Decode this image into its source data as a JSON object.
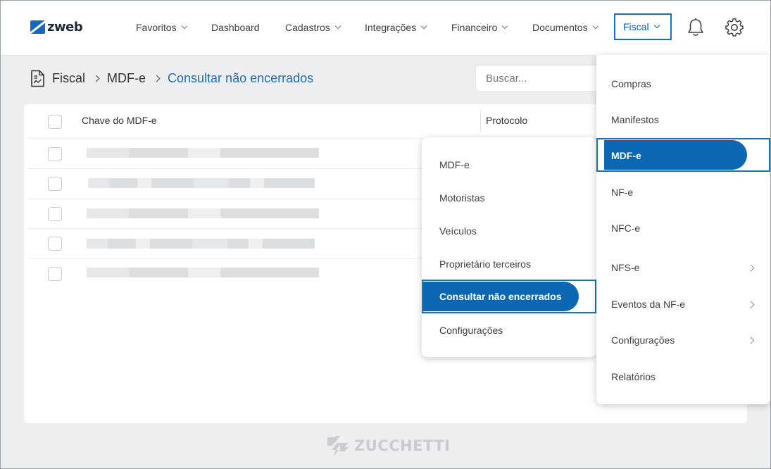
{
  "app": {
    "logo_text": "zweb"
  },
  "nav": {
    "items": [
      {
        "label": "Favoritos",
        "has_chevron": true
      },
      {
        "label": "Dashboard",
        "has_chevron": false
      },
      {
        "label": "Cadastros",
        "has_chevron": true
      },
      {
        "label": "Integrações",
        "has_chevron": true
      },
      {
        "label": "Financeiro",
        "has_chevron": true
      },
      {
        "label": "Documentos",
        "has_chevron": true
      }
    ],
    "active": {
      "label": "Fiscal",
      "has_chevron": true
    },
    "icons": [
      "bell-icon",
      "gear-icon"
    ]
  },
  "breadcrumb": {
    "icon": "document-chart-icon",
    "items": [
      "Fiscal",
      "MDF-e"
    ],
    "current": "Consultar não encerrados"
  },
  "search": {
    "placeholder": "Buscar..."
  },
  "table": {
    "columns": [
      "Chave do MDF-e",
      "Protocolo"
    ],
    "row_count": 5,
    "note_rows_blurred": true
  },
  "fiscal_menu": {
    "items": [
      {
        "label": "Compras",
        "submenu": false
      },
      {
        "label": "Manifestos",
        "submenu": false
      },
      {
        "label": "MDF-e",
        "submenu": false,
        "selected": true
      },
      {
        "label": "NF-e",
        "submenu": false
      },
      {
        "label": "NFC-e",
        "submenu": false
      },
      {
        "label": "NFS-e",
        "submenu": true
      },
      {
        "label": "Eventos da NF-e",
        "submenu": true
      },
      {
        "label": "Configurações",
        "submenu": true
      },
      {
        "label": "Relatórios",
        "submenu": false
      }
    ]
  },
  "mdfe_submenu": {
    "items": [
      {
        "label": "MDF-e"
      },
      {
        "label": "Motoristas"
      },
      {
        "label": "Veículos"
      },
      {
        "label": "Proprietário terceiros"
      },
      {
        "label": "Consultar não encerrados",
        "selected": true
      },
      {
        "label": "Configurações"
      }
    ]
  },
  "footer": {
    "brand": "ZUCCHETTI"
  },
  "colors": {
    "accent": "#0b67b2",
    "highlight_border": "#1a73b8",
    "breadcrumb_current": "#1f6fb5"
  }
}
